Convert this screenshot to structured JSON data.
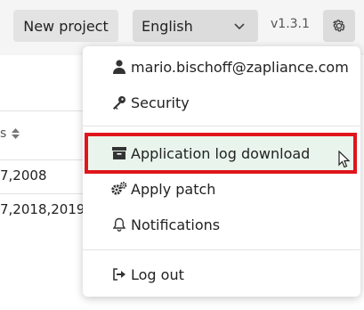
{
  "toolbar": {
    "new_project_label": "New project",
    "language_selected": "English",
    "version": "v1.3.1"
  },
  "table": {
    "column_header_partial": "s",
    "rows": [
      "7,2008",
      "7,2018,2019,"
    ]
  },
  "user_menu": {
    "items": [
      {
        "label": "mario.bischoff@zapliance.com",
        "icon": "user-icon"
      },
      {
        "label": "Security",
        "icon": "key-icon"
      },
      {
        "label": "Application log download",
        "icon": "archive-icon",
        "highlighted": true
      },
      {
        "label": "Apply patch",
        "icon": "gears-icon"
      },
      {
        "label": "Notifications",
        "icon": "bell-icon"
      },
      {
        "label": "Log out",
        "icon": "logout-icon"
      }
    ]
  },
  "colors": {
    "highlight_border": "#e0151b",
    "highlight_fill": "#e9f5ec"
  }
}
